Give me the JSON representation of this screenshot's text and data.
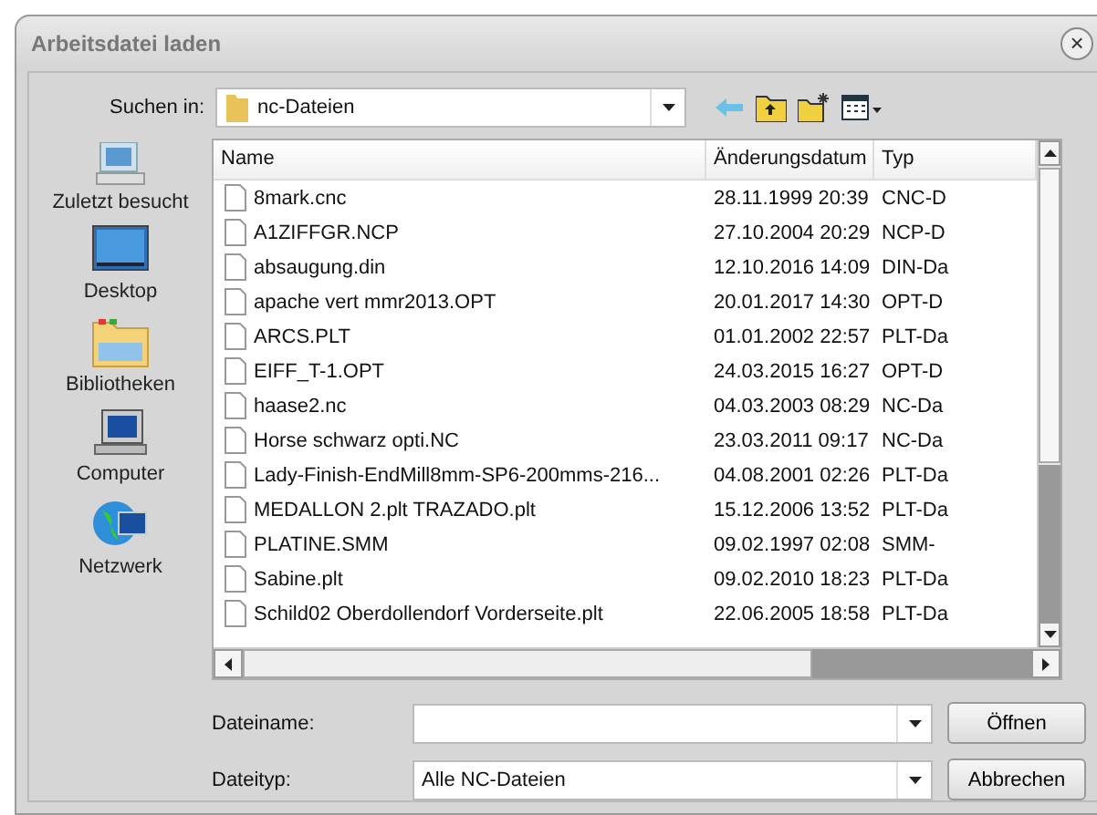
{
  "window": {
    "title": "Arbeitsdatei laden",
    "close": "×"
  },
  "toolbar": {
    "label": "Suchen in:",
    "folder": "nc-Dateien"
  },
  "sidebar": {
    "items": [
      {
        "label": "Zuletzt besucht",
        "kind": "recent"
      },
      {
        "label": "Desktop",
        "kind": "desktop"
      },
      {
        "label": "Bibliotheken",
        "kind": "libraries"
      },
      {
        "label": "Computer",
        "kind": "computer"
      },
      {
        "label": "Netzwerk",
        "kind": "network"
      }
    ]
  },
  "table": {
    "columns": [
      "Name",
      "Änderungsdatum",
      "Typ"
    ],
    "rows": [
      {
        "name": "8mark.cnc",
        "date": "28.11.1999 20:39",
        "type": "CNC-D"
      },
      {
        "name": "A1ZIFFGR.NCP",
        "date": "27.10.2004 20:29",
        "type": "NCP-D"
      },
      {
        "name": "absaugung.din",
        "date": "12.10.2016 14:09",
        "type": "DIN-Da"
      },
      {
        "name": "apache vert mmr2013.OPT",
        "date": "20.01.2017 14:30",
        "type": "OPT-D"
      },
      {
        "name": "ARCS.PLT",
        "date": "01.01.2002 22:57",
        "type": "PLT-Da"
      },
      {
        "name": "EIFF_T-1.OPT",
        "date": "24.03.2015 16:27",
        "type": "OPT-D"
      },
      {
        "name": "haase2.nc",
        "date": "04.03.2003 08:29",
        "type": "NC-Da"
      },
      {
        "name": "Horse schwarz opti.NC",
        "date": "23.03.2011 09:17",
        "type": "NC-Da"
      },
      {
        "name": "Lady-Finish-EndMill8mm-SP6-200mms-216...",
        "date": "04.08.2001 02:26",
        "type": "PLT-Da"
      },
      {
        "name": "MEDALLON 2.plt TRAZADO.plt",
        "date": "15.12.2006 13:52",
        "type": "PLT-Da"
      },
      {
        "name": "PLATINE.SMM",
        "date": "09.02.1997 02:08",
        "type": "SMM-"
      },
      {
        "name": "Sabine.plt",
        "date": "09.02.2010 18:23",
        "type": "PLT-Da"
      },
      {
        "name": "Schild02 Oberdollendorf Vorderseite.plt",
        "date": "22.06.2005 18:58",
        "type": "PLT-Da"
      }
    ]
  },
  "form": {
    "filename": {
      "label": "Dateiname:"
    },
    "filetype": {
      "label": "Dateityp:",
      "value": "Alle NC-Dateien"
    }
  },
  "buttons": [
    "Öffnen",
    "Abbrechen"
  ]
}
